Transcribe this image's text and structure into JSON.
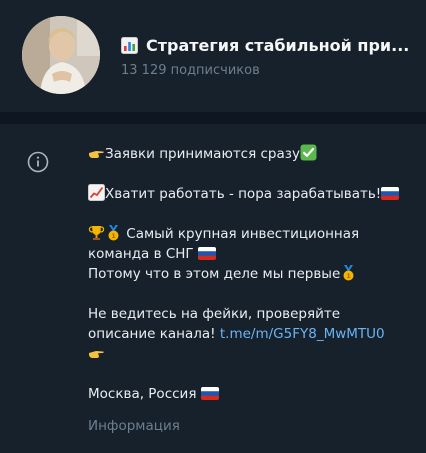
{
  "channel": {
    "title": "Стратегия стабильной при...",
    "subscribers": "13 129 подписчиков",
    "avatar_icon": "channel-avatar-photo",
    "title_icon": "bar-chart-emoji"
  },
  "description": {
    "line1": "Заявки принимаются сразу",
    "line2": "Хватит работать - пора зарабатывать!",
    "line3a": " Самый крупная инвестиционная",
    "line3b": "команда в СНГ ",
    "line3c": "Потому что в этом деле мы первые",
    "line4a": "Не ведитесь на фейки, проверяйте",
    "line4b": "описание канала!  ",
    "link": "t.me/m/G5FY8_MwMTU0",
    "line5": "Москва, Россия "
  },
  "info_label": "Информация",
  "colors": {
    "background": "#17212b",
    "divider": "#0e1621",
    "link": "#6ab3f3",
    "muted": "#6d7f8f"
  }
}
